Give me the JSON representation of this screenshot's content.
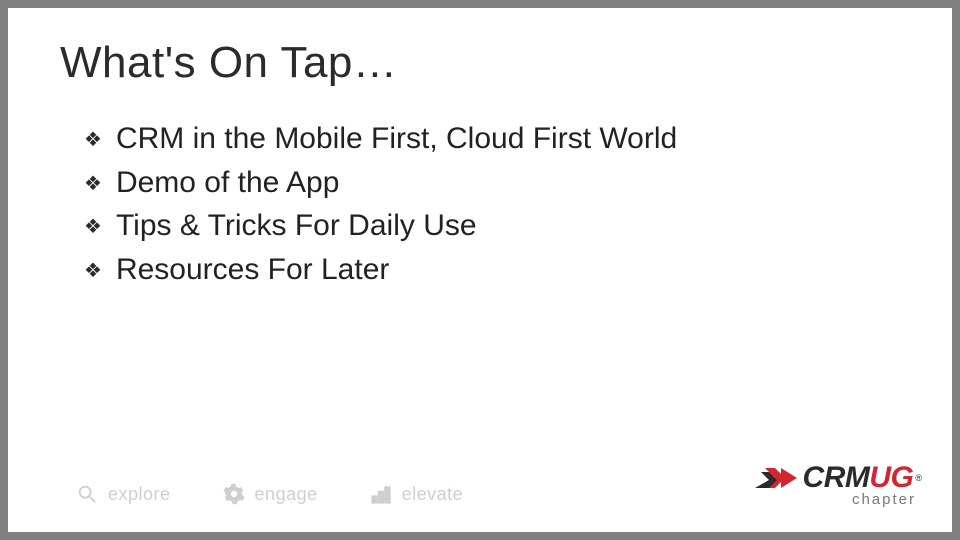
{
  "title": "What's On Tap…",
  "bullets": [
    "CRM in the Mobile First, Cloud First World",
    "Demo of the App",
    "Tips & Tricks For Daily Use",
    "Resources For Later"
  ],
  "footer": {
    "items": [
      {
        "icon": "magnifier-icon",
        "label": "explore"
      },
      {
        "icon": "gear-icon",
        "label": "engage"
      },
      {
        "icon": "steps-icon",
        "label": "elevate"
      }
    ]
  },
  "logo": {
    "crm": "CRM",
    "ug": "UG",
    "reg": "®",
    "chapter": "chapter"
  },
  "colors": {
    "frame": "#808080",
    "accent_red": "#d22730",
    "text": "#2b2b2b",
    "footer_gray": "#cfcfcf"
  }
}
